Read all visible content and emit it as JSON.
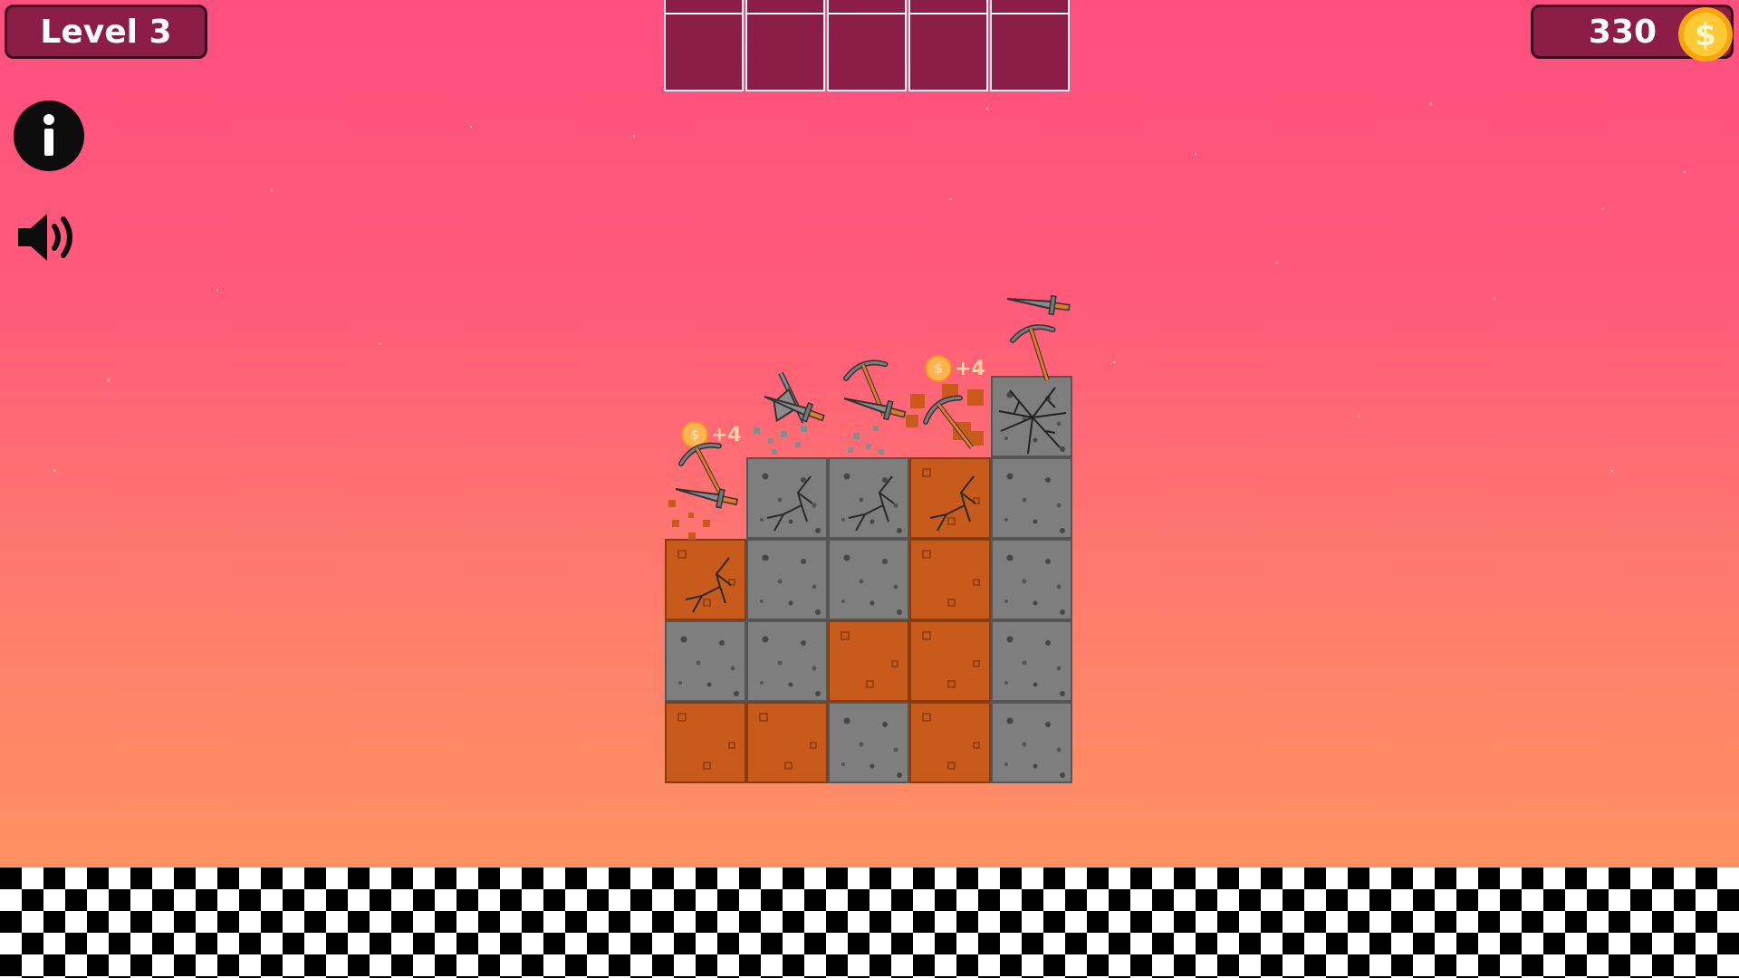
{
  "hud": {
    "level_label": "Level 3",
    "coins": "330",
    "coin_icon": "dollar-coin-icon"
  },
  "slots_count": 5,
  "buttons": {
    "info_icon": "info-icon",
    "sound_icon": "speaker-icon"
  },
  "rewards": [
    {
      "text": "+4"
    },
    {
      "text": "+4"
    }
  ],
  "board": {
    "columns": 5,
    "rows": 5,
    "cells": [
      [
        "empty",
        "stone-cracked",
        "stone-cracked",
        "dirt-cracked",
        "stone"
      ],
      [
        "dirt-cracked",
        "stone",
        "stone",
        "dirt",
        "stone"
      ],
      [
        "stone",
        "stone",
        "dirt",
        "dirt",
        "stone"
      ],
      [
        "dirt",
        "dirt",
        "stone",
        "dirt",
        "stone"
      ]
    ],
    "top_block": "stone-cracked"
  },
  "colors": {
    "panel": "#8b1d47",
    "stone": "#7e7e7e",
    "dirt": "#c85a1c",
    "coin": "#ffc24a"
  }
}
